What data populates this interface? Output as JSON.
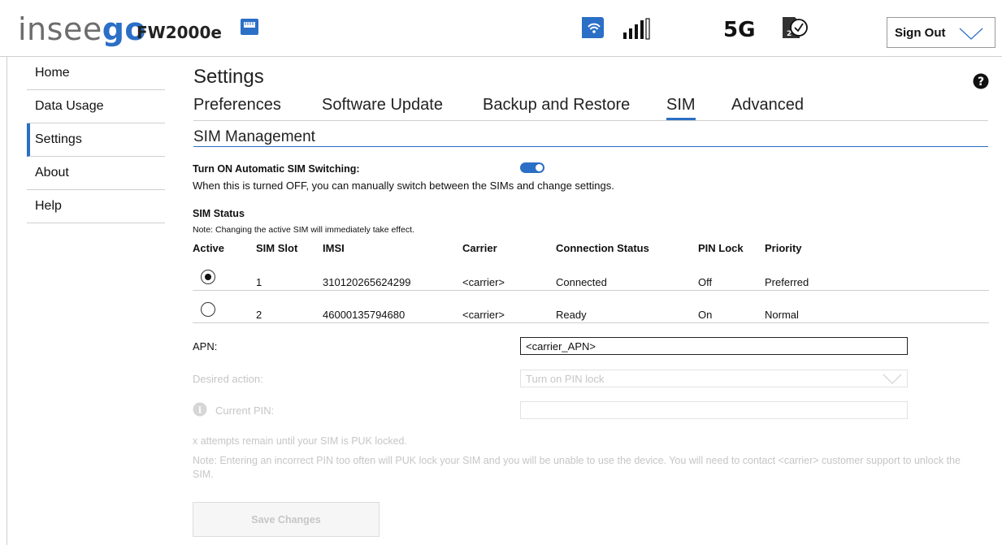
{
  "header": {
    "brand_main": "insee",
    "brand_accent": "go",
    "model": "FW2000e",
    "technology": "5G",
    "sign_out_label": "Sign Out",
    "icons": [
      "ethernet-icon",
      "wifi-device-icon",
      "signal-strength-icon",
      "sim-check-icon",
      "chevron-down-icon"
    ]
  },
  "sidebar": {
    "items": [
      {
        "label": "Home",
        "active": false
      },
      {
        "label": "Data Usage",
        "active": false
      },
      {
        "label": "Settings",
        "active": true
      },
      {
        "label": "About",
        "active": false
      },
      {
        "label": "Help",
        "active": false
      }
    ]
  },
  "page": {
    "title": "Settings",
    "tabs": [
      {
        "label": "Preferences",
        "active": false
      },
      {
        "label": "Software Update",
        "active": false
      },
      {
        "label": "Backup and Restore",
        "active": false
      },
      {
        "label": "SIM",
        "active": true
      },
      {
        "label": "Advanced",
        "active": false
      }
    ],
    "section_title": "SIM Management"
  },
  "auto_switch": {
    "label": "Turn ON Automatic SIM Switching:",
    "enabled": true,
    "description": "When this is turned OFF, you can manually switch between the SIMs and change settings."
  },
  "sim_status": {
    "title": "SIM Status",
    "note": "Note: Changing the active SIM will immediately take effect.",
    "columns": [
      "Active",
      "SIM Slot",
      "IMSI",
      "Carrier",
      "Connection Status",
      "PIN Lock",
      "Priority"
    ],
    "rows": [
      {
        "active": true,
        "slot": "1",
        "imsi": "310120265624299",
        "carrier": "<carrier>",
        "connection": "Connected",
        "pin_lock": "Off",
        "priority": "Preferred"
      },
      {
        "active": false,
        "slot": "2",
        "imsi": "46000135794680",
        "carrier": "<carrier>",
        "connection": "Ready",
        "pin_lock": "On",
        "priority": "Normal"
      }
    ]
  },
  "form": {
    "apn_label": "APN:",
    "apn_value": "<carrier_APN>",
    "desired_action_label": "Desired action:",
    "desired_action_value": "Turn on PIN lock",
    "current_pin_label": "Current PIN:",
    "current_pin_value": "",
    "attempts_text": "x attempts remain until your SIM is PUK locked.",
    "warning_note": "Note: Entering an incorrect PIN too often will PUK lock your SIM and you will be unable to use the device. You will need to contact <carrier> customer support to unlock the SIM.",
    "save_label": "Save Changes"
  },
  "colors": {
    "accent": "#2b6fc6",
    "disabled_text": "#c6c6c6",
    "divider": "#cfcfcf"
  }
}
